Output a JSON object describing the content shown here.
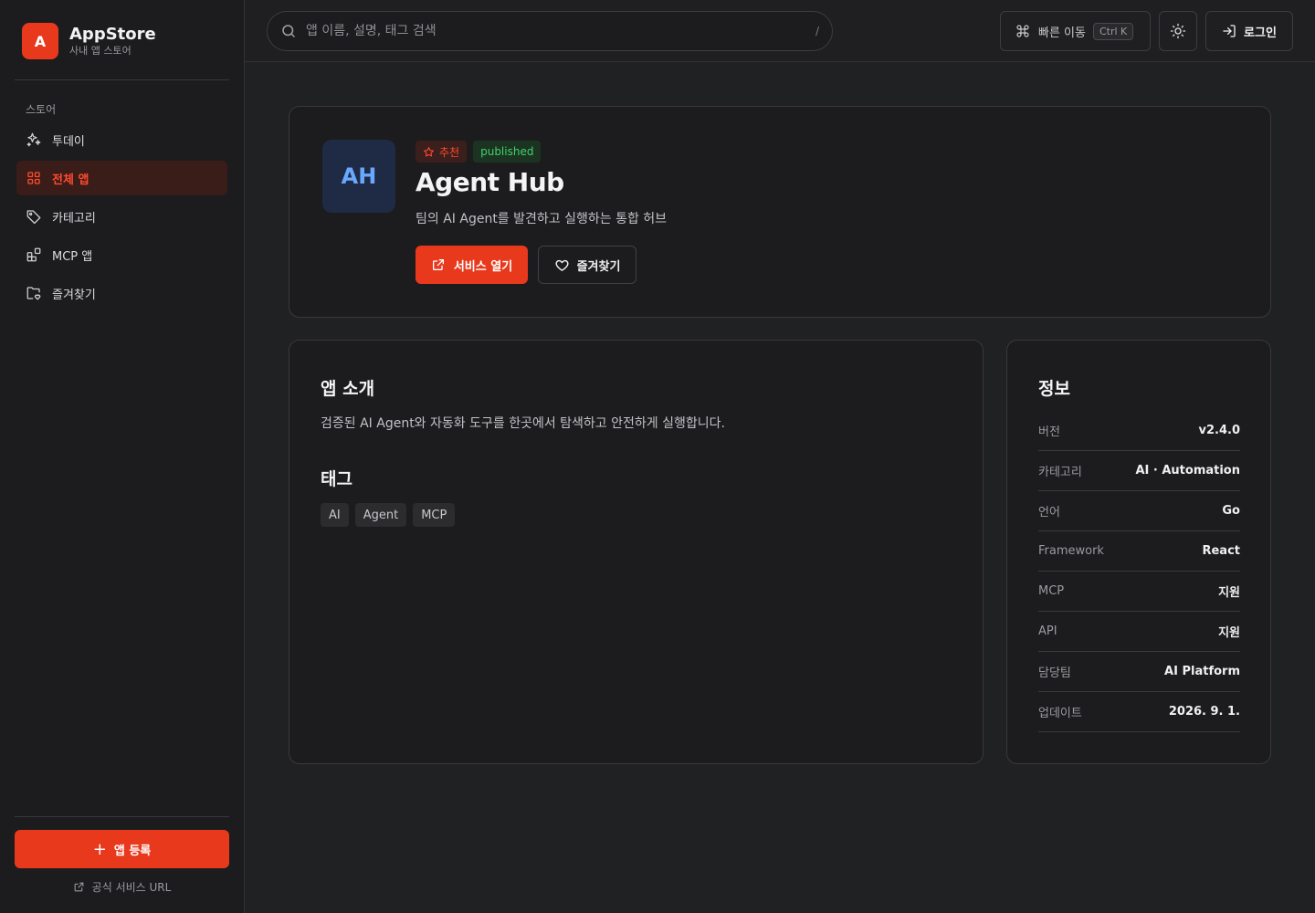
{
  "brand": {
    "logo_letter": "A",
    "name": "AppStore",
    "subtitle": "사내 앱 스토어"
  },
  "sidebar": {
    "section_label": "스토어",
    "items": [
      {
        "label": "투데이",
        "icon": "sparkles-icon",
        "active": false
      },
      {
        "label": "전체 앱",
        "icon": "grid-icon",
        "active": true
      },
      {
        "label": "카테고리",
        "icon": "tag-icon",
        "active": false
      },
      {
        "label": "MCP 앱",
        "icon": "blocks-icon",
        "active": false
      },
      {
        "label": "즐겨찾기",
        "icon": "folder-heart-icon",
        "active": false
      }
    ],
    "register_button": "앱 등록",
    "official_link": "공식 서비스 URL"
  },
  "topbar": {
    "search_placeholder": "앱 이름, 설명, 태그 검색",
    "search_shortcut": "/",
    "quick_nav_label": "빠른 이동",
    "quick_nav_kbd": "Ctrl K",
    "login_label": "로그인"
  },
  "app": {
    "icon_text": "AH",
    "badge_featured": "추천",
    "badge_status": "published",
    "name": "Agent Hub",
    "description": "팀의 AI Agent를 발견하고 실행하는 통합 허브",
    "open_button": "서비스 열기",
    "favorite_button": "즐겨찾기"
  },
  "about": {
    "title": "앱 소개",
    "text": "검증된 AI Agent와 자동화 도구를 한곳에서 탐색하고 안전하게 실행합니다.",
    "tags_title": "태그",
    "tags": [
      "AI",
      "Agent",
      "MCP"
    ]
  },
  "info": {
    "title": "정보",
    "rows": [
      {
        "key": "버전",
        "value": "v2.4.0"
      },
      {
        "key": "카테고리",
        "value": "AI · Automation"
      },
      {
        "key": "언어",
        "value": "Go"
      },
      {
        "key": "Framework",
        "value": "React"
      },
      {
        "key": "MCP",
        "value": "지원"
      },
      {
        "key": "API",
        "value": "지원"
      },
      {
        "key": "담당팀",
        "value": "AI Platform"
      },
      {
        "key": "업데이트",
        "value": "2026. 9. 1."
      }
    ]
  },
  "colors": {
    "accent": "#e8391d",
    "background": "#202123",
    "status_published": "#3fd26a"
  }
}
